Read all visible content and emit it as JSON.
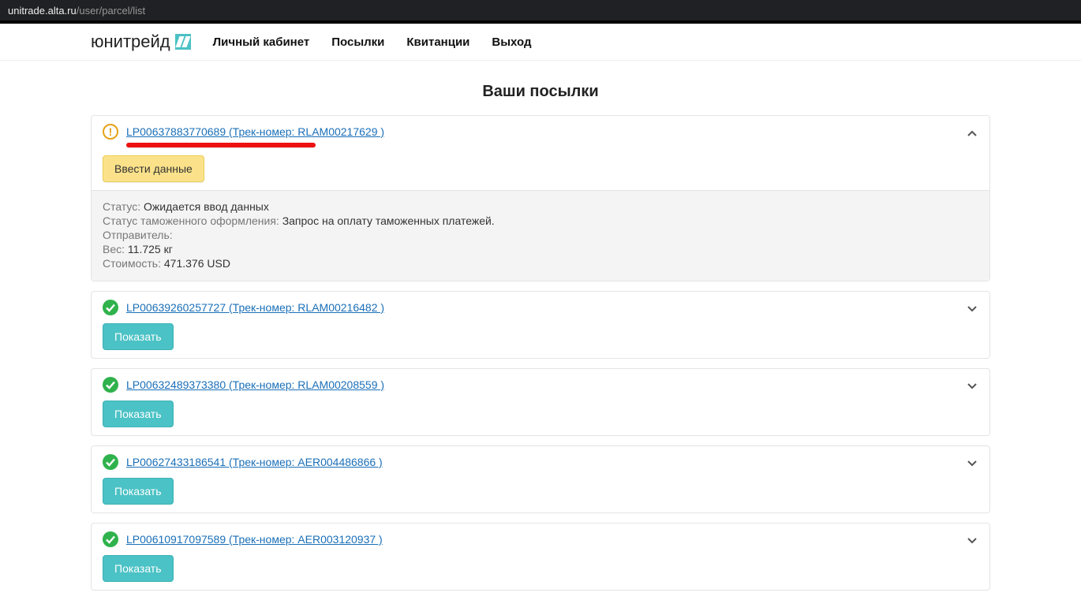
{
  "browser": {
    "host": "unitrade.alta.ru",
    "path": "/user/parcel/list"
  },
  "brand": {
    "name": "юнитрейд"
  },
  "nav": {
    "cabinet": "Личный кабинет",
    "parcels": "Посылки",
    "receipts": "Квитанции",
    "logout": "Выход"
  },
  "page": {
    "title": "Ваши посылки"
  },
  "btn": {
    "enter_data": "Ввести данные",
    "show": "Показать"
  },
  "details": {
    "status_label": "Статус:",
    "customs_label": "Статус таможенного оформления:",
    "sender_label": "Отправитель:",
    "weight_label": "Вес:",
    "cost_label": "Стоимость:"
  },
  "parcels": [
    {
      "status": "warn",
      "link": "LP00637883770689 (Трек-номер: RLAM00217629 )",
      "action": "enter_data",
      "expanded": true,
      "d": {
        "status": "Ожидается ввод данных",
        "customs": "Запрос на оплату таможенных платежей.",
        "sender": "",
        "weight": "11.725 кг",
        "cost": "471.376 USD"
      }
    },
    {
      "status": "ok",
      "link": "LP00639260257727 (Трек-номер: RLAM00216482 )",
      "action": "show",
      "expanded": false
    },
    {
      "status": "ok",
      "link": "LP00632489373380 (Трек-номер: RLAM00208559 )",
      "action": "show",
      "expanded": false
    },
    {
      "status": "ok",
      "link": "LP00627433186541 (Трек-номер: AER004486866 )",
      "action": "show",
      "expanded": false
    },
    {
      "status": "ok",
      "link": "LP00610917097589 (Трек-номер: AER003120937 )",
      "action": "show",
      "expanded": false
    }
  ]
}
